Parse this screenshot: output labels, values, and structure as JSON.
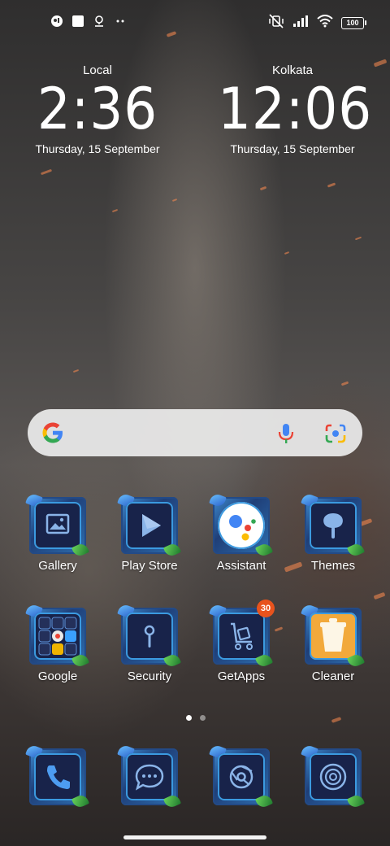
{
  "status_bar": {
    "left_icons": [
      "app-notification-icon",
      "square-notification-icon",
      "location-notification-icon",
      "more-notifications-icon"
    ],
    "right_icons": [
      "mute-vibrate-icon",
      "signal-icon",
      "wifi-icon",
      "battery-icon"
    ],
    "battery": "100"
  },
  "clocks": {
    "local": {
      "city": "Local",
      "time": "2:36",
      "date": "Thursday, 15 September"
    },
    "remote": {
      "city": "Kolkata",
      "time": "12:06",
      "date": "Thursday, 15 September"
    }
  },
  "search": {
    "icons": [
      "google-g-icon",
      "microphone-icon",
      "google-lens-icon"
    ]
  },
  "apps_row1": [
    {
      "label": "Gallery",
      "icon": "gallery-icon"
    },
    {
      "label": "Play Store",
      "icon": "play-store-icon"
    },
    {
      "label": "Assistant",
      "icon": "assistant-icon"
    },
    {
      "label": "Themes",
      "icon": "themes-icon"
    }
  ],
  "apps_row2": [
    {
      "label": "Google",
      "icon": "google-folder-icon"
    },
    {
      "label": "Security",
      "icon": "security-icon"
    },
    {
      "label": "GetApps",
      "icon": "getapps-icon",
      "badge": "30"
    },
    {
      "label": "Cleaner",
      "icon": "cleaner-icon"
    }
  ],
  "dock": [
    {
      "icon": "phone-icon"
    },
    {
      "icon": "messages-icon"
    },
    {
      "icon": "browser-icon"
    },
    {
      "icon": "camera-icon"
    }
  ],
  "page_indicator": {
    "pages": 2,
    "current": 1
  },
  "colors": {
    "badge": "#e8531d",
    "search_bg": "#ebebeb",
    "icon_frame": "#18234a"
  }
}
